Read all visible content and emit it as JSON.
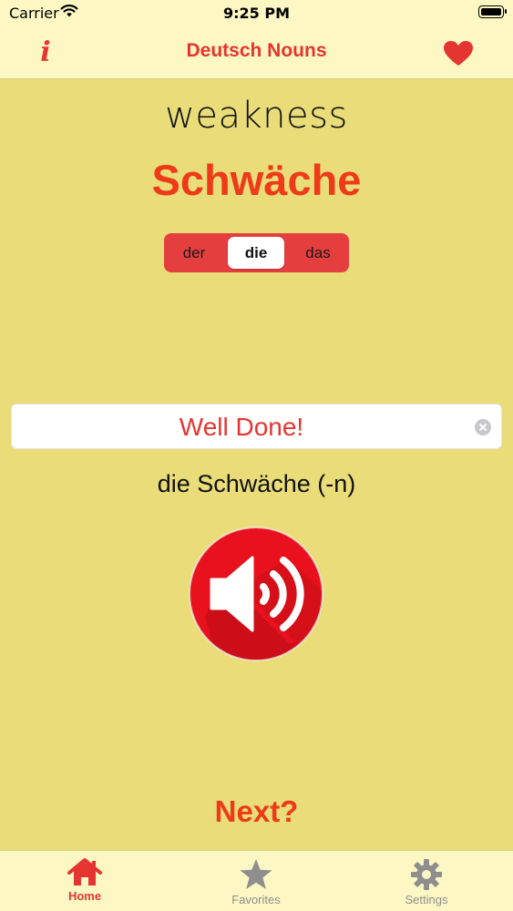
{
  "status_bar": {
    "carrier": "Carrier",
    "time": "9:25 PM"
  },
  "nav": {
    "title": "Deutsch Nouns",
    "info_icon": "i",
    "favorite_icon": "heart-icon"
  },
  "card": {
    "english": "weakness",
    "german": "Schwäche",
    "articles": [
      "der",
      "die",
      "das"
    ],
    "selected_article": "die",
    "answer_value": "Well Done!",
    "full_noun": "die Schwäche (-n)",
    "speaker_icon": "speaker-icon"
  },
  "next_label": "Next?",
  "tabs": [
    {
      "label": "Home",
      "icon": "house-icon",
      "active": true
    },
    {
      "label": "Favorites",
      "icon": "star-icon",
      "active": false
    },
    {
      "label": "Settings",
      "icon": "gear-icon",
      "active": false
    }
  ],
  "colors": {
    "background": "#e9dc79",
    "bar_background": "#fdf7c3",
    "accent_red": "#e53530",
    "title_orange_red": "#ee3a18",
    "inactive_gray": "#8e8e8e"
  }
}
